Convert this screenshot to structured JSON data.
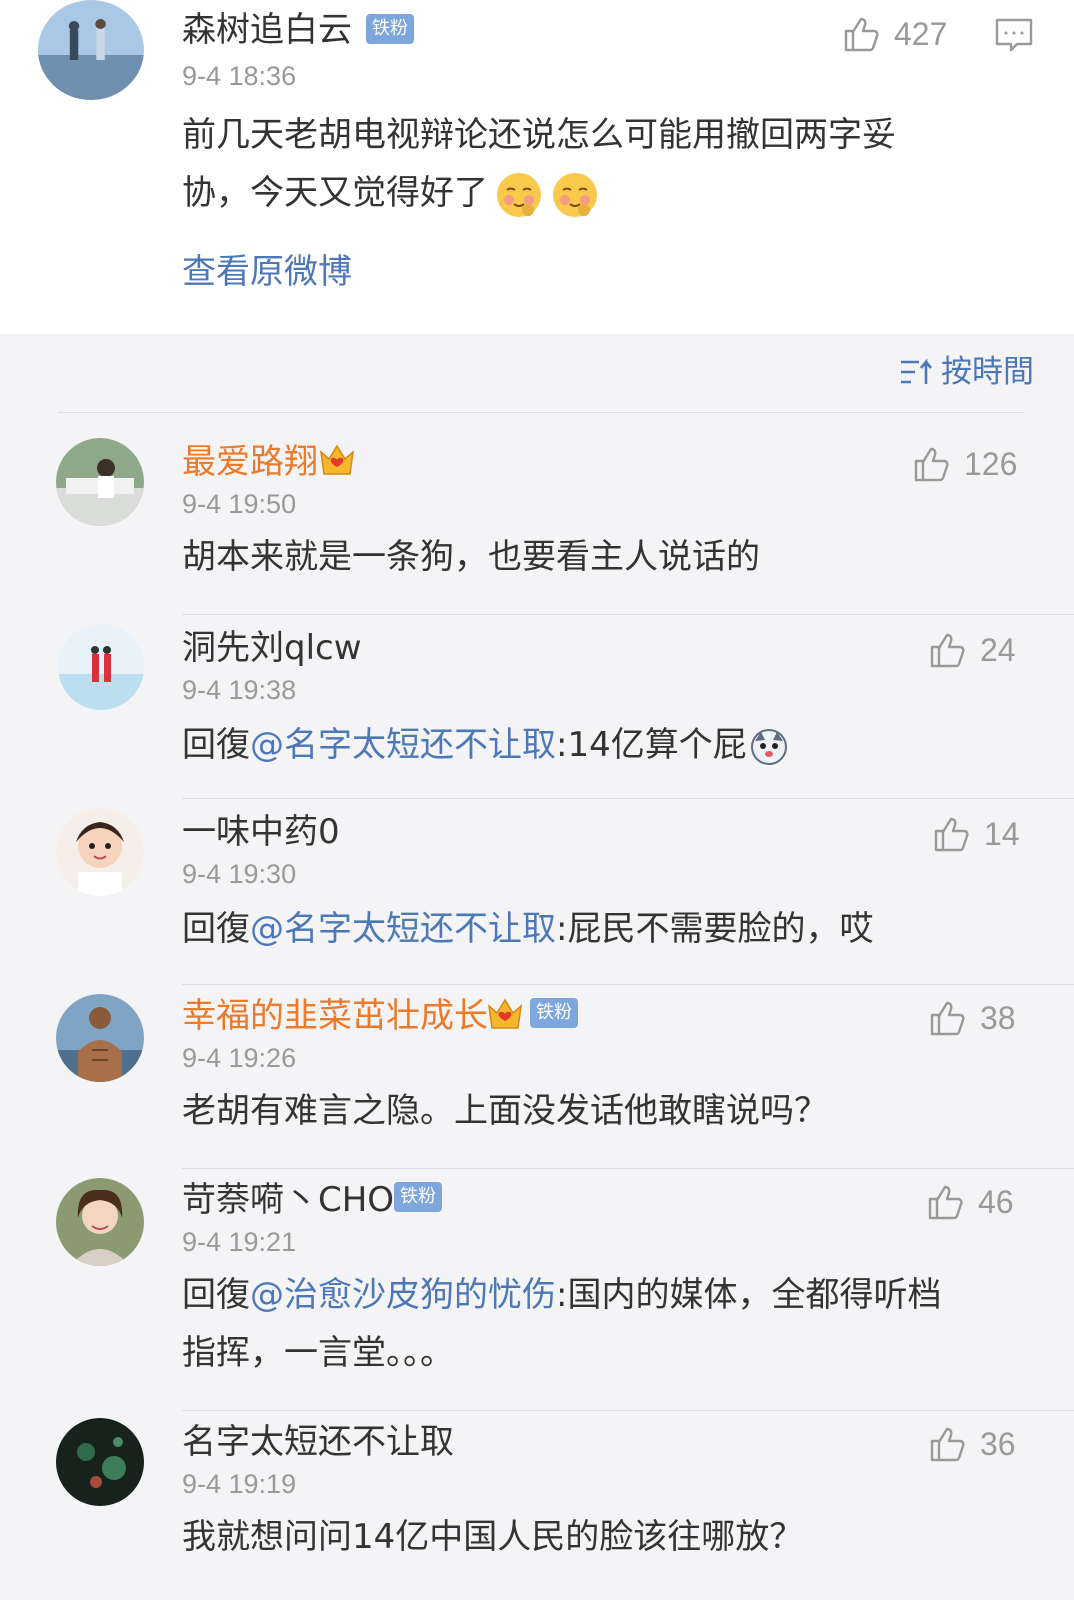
{
  "root": {
    "user": "森树追白云",
    "badge": "铁粉",
    "time": "9-4 18:36",
    "likes": "427",
    "text_line1": "前几天老胡电视辩论还说怎么可能用撤回两字妥",
    "text_line2": "协，今天又觉得好了",
    "view_original": "查看原微博"
  },
  "sort_label": "按時間",
  "comments": [
    {
      "user": "最爱路翔",
      "time": "9-4 19:50",
      "likes": "126",
      "text": "胡本来就是一条狗，也要看主人说话的"
    },
    {
      "user": "洞先刘qlcw",
      "time": "9-4 19:38",
      "likes": "24",
      "reply_prefix": "回復",
      "mention": "@名字太短还不让取",
      "text": ":14亿算个屁"
    },
    {
      "user": "一味中药0",
      "time": "9-4 19:30",
      "likes": "14",
      "reply_prefix": "回復",
      "mention": "@名字太短还不让取",
      "text": ":屁民不需要脸的，哎"
    },
    {
      "user": "幸福的韭菜茁壮成长",
      "badge": "铁粉",
      "time": "9-4 19:26",
      "likes": "38",
      "text": "老胡有难言之隐。上面没发话他敢瞎说吗？"
    },
    {
      "user": "苛萘嗬丶CHO",
      "badge": "铁粉",
      "time": "9-4 19:21",
      "likes": "46",
      "reply_prefix": "回復",
      "mention": "@治愈沙皮狗的忧伤",
      "text": ":国内的媒体，全都得听档",
      "text_line2": "指挥，一言堂。。。"
    },
    {
      "user": "名字太短还不让取",
      "time": "9-4 19:19",
      "likes": "36",
      "text": "我就想问问14亿中国人民的脸该往哪放？"
    }
  ]
}
